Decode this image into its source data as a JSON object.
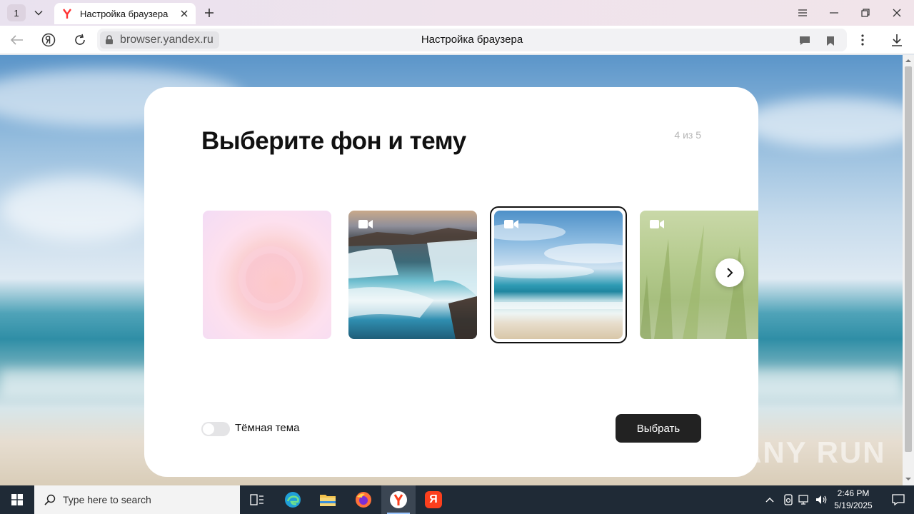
{
  "browser": {
    "tab_counter": "1",
    "tab": {
      "title": "Настройка браузера"
    },
    "address": {
      "url": "browser.yandex.ru",
      "page_title": "Настройка браузера"
    }
  },
  "page": {
    "heading": "Выберите фон и тему",
    "step": "4 из 5",
    "backgrounds": [
      {
        "name": "pink-gradient",
        "video": false,
        "selected": false
      },
      {
        "name": "waterfall",
        "video": true,
        "selected": false
      },
      {
        "name": "sea-beach",
        "video": true,
        "selected": true
      },
      {
        "name": "grass",
        "video": true,
        "selected": false
      }
    ],
    "dark_theme": {
      "label": "Тёмная тема",
      "enabled": false
    },
    "select_button": "Выбрать"
  },
  "watermark": "ANY RUN",
  "taskbar": {
    "search_placeholder": "Type here to search",
    "time": "2:46 PM",
    "date": "5/19/2025",
    "yandex_letter": "Я"
  },
  "colors": {
    "accent": "#222222",
    "yandex_red": "#fc3f1d"
  }
}
